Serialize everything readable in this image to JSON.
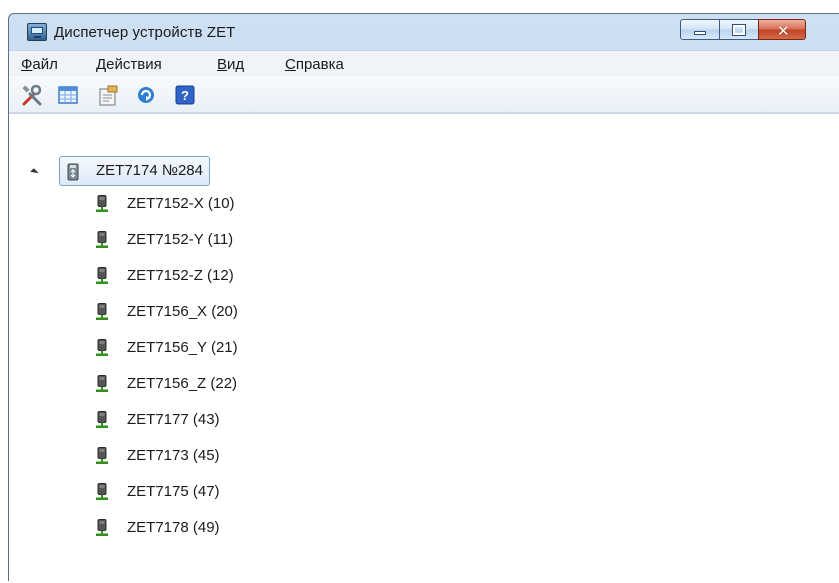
{
  "window": {
    "title": "Диспетчер устройств ZET",
    "icon": "device-manager-icon",
    "controls": {
      "minimize_icon": "minimize-icon",
      "maximize_icon": "maximize-icon",
      "close_icon": "close-icon",
      "close_glyph": "✕"
    }
  },
  "menu": {
    "items": [
      {
        "label": "Файл",
        "underline": "Ф",
        "rest": "айл"
      },
      {
        "label": "Действия",
        "underline": "Д",
        "rest": "ействия"
      },
      {
        "label": "Вид",
        "underline": "В",
        "rest": "ид"
      },
      {
        "label": "Справка",
        "underline": "С",
        "rest": "правка"
      }
    ]
  },
  "toolbar": {
    "buttons": [
      {
        "icon": "tools-icon"
      },
      {
        "icon": "table-icon"
      },
      {
        "icon": "properties-icon"
      },
      {
        "icon": "refresh-icon"
      },
      {
        "icon": "help-icon",
        "glyph": "?"
      }
    ]
  },
  "tree": {
    "root": {
      "label": "ZET7174 №284",
      "icon": "usb-device-icon",
      "expanded": true
    },
    "children": [
      {
        "label": "ZET7152-X (10)",
        "icon": "sensor-icon"
      },
      {
        "label": "ZET7152-Y (11)",
        "icon": "sensor-icon"
      },
      {
        "label": "ZET7152-Z (12)",
        "icon": "sensor-icon"
      },
      {
        "label": "ZET7156_X (20)",
        "icon": "sensor-icon"
      },
      {
        "label": "ZET7156_Y (21)",
        "icon": "sensor-icon"
      },
      {
        "label": "ZET7156_Z (22)",
        "icon": "sensor-icon"
      },
      {
        "label": "ZET7177 (43)",
        "icon": "sensor-icon"
      },
      {
        "label": "ZET7173 (45)",
        "icon": "sensor-icon"
      },
      {
        "label": "ZET7175 (47)",
        "icon": "sensor-icon"
      },
      {
        "label": "ZET7178 (49)",
        "icon": "sensor-icon"
      }
    ]
  },
  "colors": {
    "sensor_green": "#2f8f1f",
    "sensor_body": "#4a4a4a",
    "selection_border": "#7da2ce"
  }
}
